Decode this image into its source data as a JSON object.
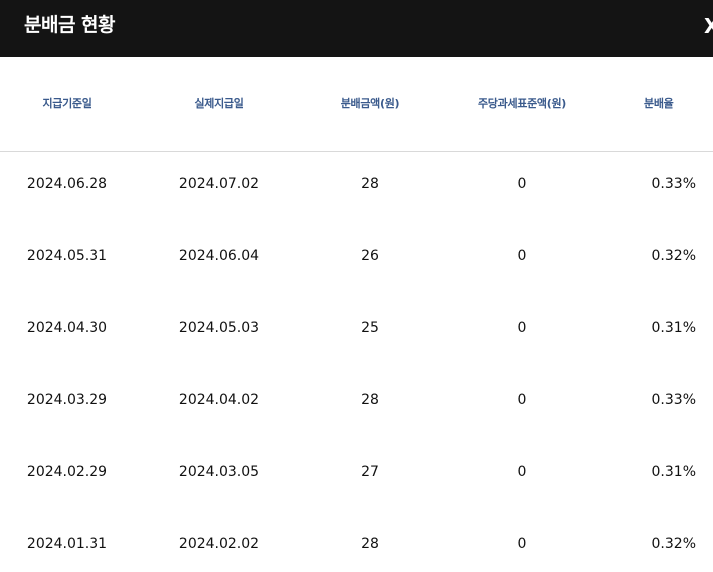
{
  "header": {
    "title": "분배금 현황",
    "close_label": "X"
  },
  "table": {
    "columns": [
      "지급기준일",
      "실제지급일",
      "분배금액(원)",
      "주당과세표준액(원)",
      "분배율"
    ],
    "rows": [
      [
        "2024.06.28",
        "2024.07.02",
        "28",
        "0",
        "0.33%"
      ],
      [
        "2024.05.31",
        "2024.06.04",
        "26",
        "0",
        "0.32%"
      ],
      [
        "2024.04.30",
        "2024.05.03",
        "25",
        "0",
        "0.31%"
      ],
      [
        "2024.03.29",
        "2024.04.02",
        "28",
        "0",
        "0.33%"
      ],
      [
        "2024.02.29",
        "2024.03.05",
        "27",
        "0",
        "0.31%"
      ],
      [
        "2024.01.31",
        "2024.02.02",
        "28",
        "0",
        "0.32%"
      ]
    ]
  },
  "colors": {
    "header_bg": "#141414",
    "header_text": "#ffffff",
    "column_header_text": "#3a5a8c",
    "cell_text": "#111111",
    "divider": "#d9d9d9"
  }
}
